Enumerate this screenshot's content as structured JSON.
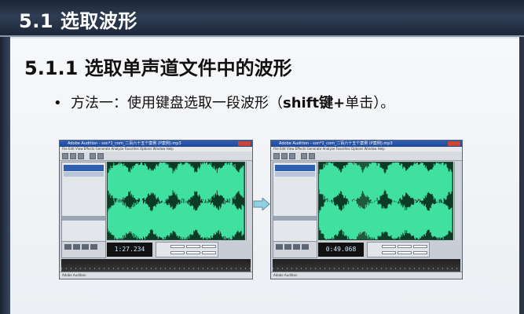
{
  "slide": {
    "title": "5.1 选取波形",
    "heading": "5.1.1  选取单声道文件中的波形",
    "bullet": {
      "marker": "•",
      "text_prefix": "方法一：使用键盘选取一段波形（",
      "text_bold": "shift键+",
      "text_suffix": "单击）。"
    }
  },
  "screenshots": {
    "left": {
      "window_title": "Adobe Audition - son*1_com_二百六十五个案例 (P案例).mp3",
      "time": "1:27.234",
      "status": "Adobe Audition"
    },
    "right": {
      "window_title": "Adobe Audition - son*1_com_二百六十五个案例 (P案例).mp3",
      "time": "0:49.068",
      "status": "Adobe Audition"
    },
    "menu": "File  Edit  View  Effects  Generate  Analyze  Favorites  Options  Window  Help"
  },
  "colors": {
    "title_bar": "#2f3d55",
    "waveform": "#3fe0a0",
    "waveform_bg": "#0c3b26",
    "selection_bg": "#1f5a3c",
    "arrow": "#8fd0e0"
  }
}
